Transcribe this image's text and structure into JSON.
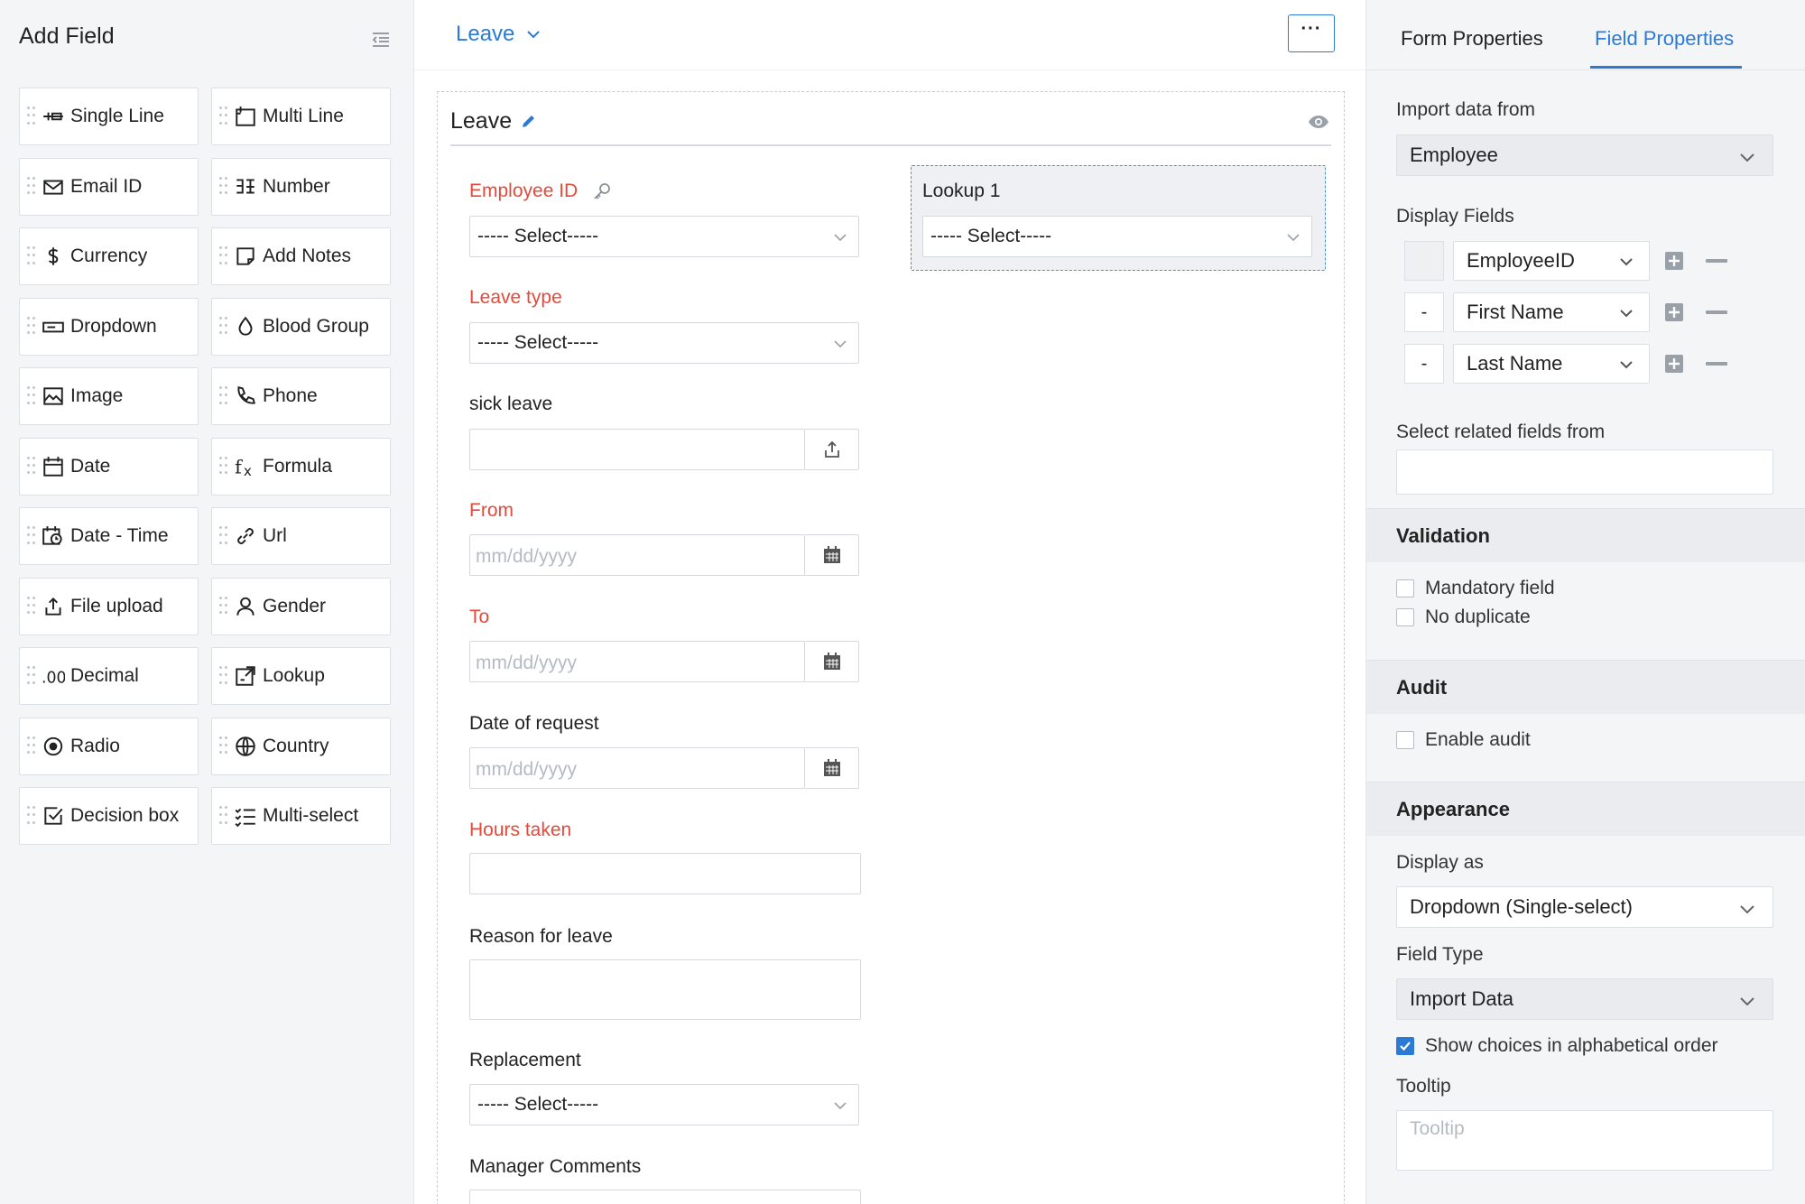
{
  "left": {
    "title": "Add Field",
    "fields": [
      {
        "label": "Single Line",
        "icon": "single-line-icon"
      },
      {
        "label": "Multi Line",
        "icon": "multi-line-icon"
      },
      {
        "label": "Email ID",
        "icon": "email-icon"
      },
      {
        "label": "Number",
        "icon": "number-icon"
      },
      {
        "label": "Currency",
        "icon": "currency-icon"
      },
      {
        "label": "Add Notes",
        "icon": "notes-icon"
      },
      {
        "label": "Dropdown",
        "icon": "dropdown-icon"
      },
      {
        "label": "Blood Group",
        "icon": "drop-icon"
      },
      {
        "label": "Image",
        "icon": "image-icon"
      },
      {
        "label": "Phone",
        "icon": "phone-icon"
      },
      {
        "label": "Date",
        "icon": "calendar-icon"
      },
      {
        "label": "Formula",
        "icon": "formula-icon"
      },
      {
        "label": "Date - Time",
        "icon": "date-time-icon"
      },
      {
        "label": "Url",
        "icon": "link-icon"
      },
      {
        "label": "File upload",
        "icon": "upload-icon"
      },
      {
        "label": "Gender",
        "icon": "person-icon"
      },
      {
        "label": "Decimal",
        "icon": "decimal-icon"
      },
      {
        "label": "Lookup",
        "icon": "lookup-icon"
      },
      {
        "label": "Radio",
        "icon": "radio-icon"
      },
      {
        "label": "Country",
        "icon": "globe-icon"
      },
      {
        "label": "Decision box",
        "icon": "checkbox-icon"
      },
      {
        "label": "Multi-select",
        "icon": "list-check-icon"
      }
    ]
  },
  "center": {
    "form_switch": "Leave",
    "more": "···",
    "form_title": "Leave",
    "fields": {
      "employee_id": {
        "label": "Employee ID",
        "value": "----- Select-----"
      },
      "lookup1": {
        "label": "Lookup 1",
        "value": "----- Select-----"
      },
      "leave_type": {
        "label": "Leave type",
        "value": "----- Select-----"
      },
      "sick_leave": {
        "label": "sick leave"
      },
      "from": {
        "label": "From",
        "placeholder": "mm/dd/yyyy"
      },
      "to": {
        "label": "To",
        "placeholder": "mm/dd/yyyy"
      },
      "date_of_request": {
        "label": "Date of request",
        "placeholder": "mm/dd/yyyy"
      },
      "hours_taken": {
        "label": "Hours taken"
      },
      "reason": {
        "label": "Reason for leave"
      },
      "replacement": {
        "label": "Replacement",
        "value": "----- Select-----"
      },
      "manager_comments": {
        "label": "Manager Comments"
      }
    }
  },
  "right": {
    "tabs": {
      "form": "Form Properties",
      "field": "Field Properties"
    },
    "import_label": "Import data from",
    "import_value": "Employee",
    "display_fields_label": "Display Fields",
    "display_fields": [
      {
        "order": "",
        "value": "EmployeeID"
      },
      {
        "order": "-",
        "value": "First Name"
      },
      {
        "order": "-",
        "value": "Last Name"
      }
    ],
    "related_label": "Select related fields from",
    "validation": {
      "title": "Validation",
      "mandatory": "Mandatory field",
      "no_duplicate": "No duplicate"
    },
    "audit": {
      "title": "Audit",
      "enable": "Enable audit"
    },
    "appearance": {
      "title": "Appearance",
      "display_as_label": "Display as",
      "display_as_value": "Dropdown (Single-select)",
      "field_type_label": "Field Type",
      "field_type_value": "Import Data",
      "alpha_order": "Show choices in alphabetical order",
      "tooltip_label": "Tooltip",
      "tooltip_placeholder": "Tooltip"
    }
  },
  "colors": {
    "accent": "#2b7bd6",
    "required": "#e5493a"
  }
}
